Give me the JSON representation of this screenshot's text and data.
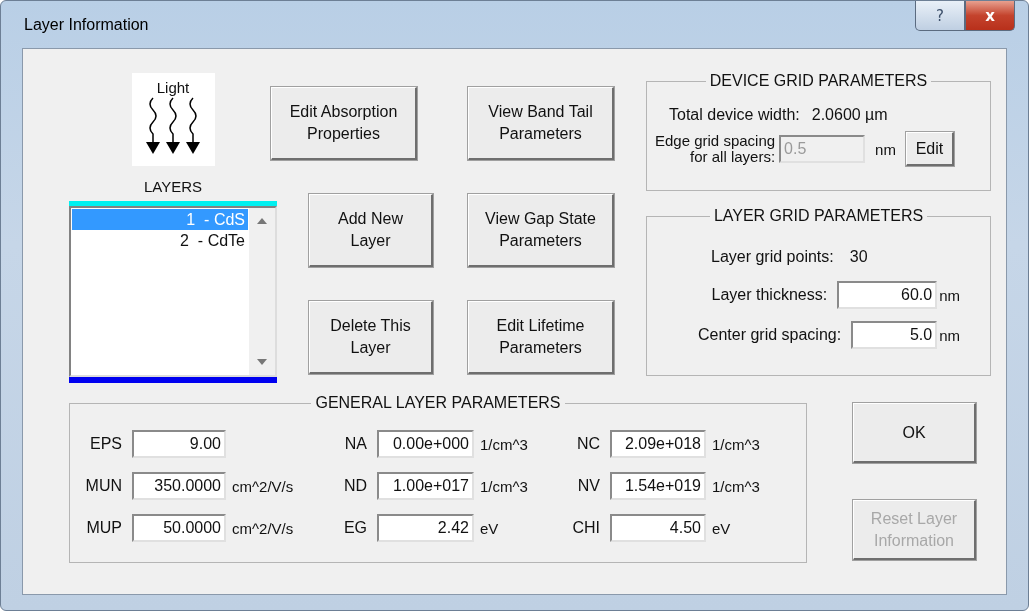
{
  "window": {
    "title": "Layer Information",
    "help_button": "?",
    "close_button": "x"
  },
  "light_icon": {
    "label": "Light"
  },
  "layers": {
    "label": "LAYERS",
    "items": [
      {
        "text": "1  - CdS",
        "selected": true
      },
      {
        "text": "2  - CdTe",
        "selected": false
      }
    ]
  },
  "action_columns": [
    [
      {
        "lines": [
          "Edit Absorption",
          "Properties"
        ]
      },
      {
        "lines": [
          "Add New",
          "Layer"
        ]
      },
      {
        "lines": [
          "Delete This",
          "Layer"
        ]
      }
    ],
    [
      {
        "lines": [
          "View Band Tail",
          "Parameters"
        ]
      },
      {
        "lines": [
          "View Gap State",
          "Parameters"
        ]
      },
      {
        "lines": [
          "Edit Lifetime",
          "Parameters"
        ]
      }
    ]
  ],
  "device_grid": {
    "title": "DEVICE GRID PARAMETERS",
    "width_label": "Total device width:",
    "width_value": "2.0600 µm",
    "edge_label": [
      "Edge grid spacing",
      "for all layers:"
    ],
    "edge_value": "0.5",
    "edge_disabled": true,
    "edge_unit": "nm",
    "edit_button": "Edit"
  },
  "layer_grid": {
    "title": "LAYER GRID PARAMETERS",
    "points_label": "Layer grid points:",
    "points_value": "30",
    "fields": [
      {
        "label": "Layer thickness:",
        "value": "60.0",
        "unit": "nm"
      },
      {
        "label": "Center grid spacing:",
        "value": "5.0",
        "unit": "nm"
      }
    ]
  },
  "general": {
    "title": "GENERAL LAYER PARAMETERS",
    "params": [
      {
        "label": "EPS",
        "value": "9.00"
      },
      {
        "label": "NA",
        "value": "0.00e+000",
        "unit": "1/cm^3"
      },
      {
        "label": "NC",
        "value": "2.09e+018",
        "unit": "1/cm^3"
      },
      {
        "label": "MUN",
        "value": "350.0000",
        "unit": "cm^2/V/s"
      },
      {
        "label": "ND",
        "value": "1.00e+017",
        "unit": "1/cm^3"
      },
      {
        "label": "NV",
        "value": "1.54e+019",
        "unit": "1/cm^3"
      },
      {
        "label": "MUP",
        "value": "50.0000",
        "unit": "cm^2/V/s"
      },
      {
        "label": "EG",
        "value": "2.42",
        "unit": "eV"
      },
      {
        "label": "CHI",
        "value": "4.50",
        "unit": "eV"
      }
    ]
  },
  "ok_button": {
    "lines": [
      "OK"
    ],
    "disabled": false
  },
  "reset_button": {
    "lines": [
      "Reset Layer",
      "Information"
    ],
    "disabled": true
  }
}
